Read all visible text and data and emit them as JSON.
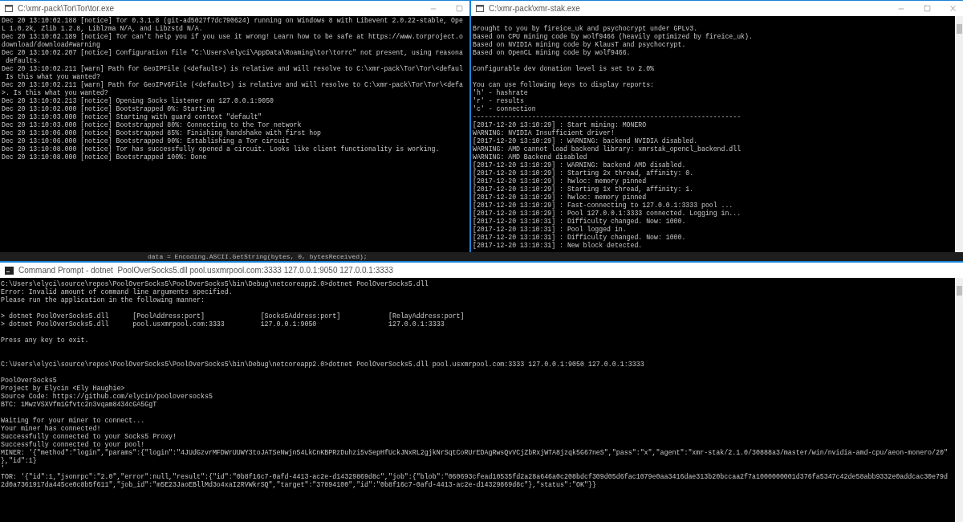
{
  "tor_window": {
    "title": "C:\\xmr-pack\\Tor\\Tor\\tor.exe",
    "groups": [
      {
        "wide_gap": false,
        "lines": [
          "Dec 20 13:10:02.188 [notice] Tor 0.3.1.8 (git-ad5027f7dc790624) running on Windows 8 with Libevent 2.0.22-stable, Ope",
          "L 1.0.2k, Zlib 1.2.8, Liblzma N/A, and Libzstd N/A.",
          "Dec 20 13:10:02.189 [notice] Tor can't help you if you use it wrong! Learn how to be safe at https://www.torproject.o",
          "download/download#warning",
          "Dec 20 13:10:02.207 [notice] Configuration file \"C:\\Users\\elyci\\AppData\\Roaming\\tor\\torrc\" not present, using reasona",
          " defaults.",
          "Dec 20 13:10:02.211 [warn] Path for GeoIPFile (<default>) is relative and will resolve to C:\\xmr-pack\\Tor\\Tor\\<defaul",
          " Is this what you wanted?",
          "Dec 20 13:10:02.211 [warn] Path for GeoIPv6File (<default>) is relative and will resolve to C:\\xmr-pack\\Tor\\Tor\\<defa",
          ">. Is this what you wanted?",
          "Dec 20 13:10:02.213 [notice] Opening Socks listener on 127.0.0.1:9050",
          "Dec 20 13:10:02.000 [notice] Bootstrapped 0%: Starting",
          "Dec 20 13:10:03.000 [notice] Starting with guard context \"default\"",
          "Dec 20 13:10:03.000 [notice] Bootstrapped 80%: Connecting to the Tor network",
          "Dec 20 13:10:06.000 [notice] Bootstrapped 85%: Finishing handshake with first hop",
          "Dec 20 13:10:06.000 [notice] Bootstrapped 90%: Establishing a Tor circuit",
          "Dec 20 13:10:08.000 [notice] Tor has successfully opened a circuit. Looks like client functionality is working.",
          "Dec 20 13:10:08.000 [notice] Bootstrapped 100%: Done"
        ]
      }
    ]
  },
  "editor_behind": {
    "code_line": "data = Encoding.ASCII.GetString(bytes, 0, bytesReceived);"
  },
  "miner_window": {
    "title": "C:\\xmr-pack\\xmr-stak.exe",
    "groups": [
      {
        "wide_gap": false,
        "lines": [
          "Brought to you by fireice_uk and psychocrypt under GPLv3.",
          "Based on CPU mining code by wolf9466 (heavily optimized by fireice_uk).",
          "Based on NVIDIA mining code by KlausT and psychocrypt.",
          "Based on OpenCL mining code by wolf9466."
        ]
      },
      {
        "wide_gap": false,
        "lines": [
          "Configurable dev donation level is set to 2.0%"
        ]
      },
      {
        "wide_gap": false,
        "lines": [
          "You can use following keys to display reports:",
          "'h' - hashrate",
          "'r' - results",
          "'c' - connection",
          "--------------------------------------------------------------------",
          "[2017-12-20 13:10:29] : Start mining: MONERO",
          "WARNING: NVIDIA Insufficient driver!",
          "[2017-12-20 13:10:29] : WARNING: backend NVIDIA disabled.",
          "WARNING: AMD cannot load backend library: xmrstak_opencl_backend.dll",
          "WARNING: AMD Backend disabled",
          "[2017-12-20 13:10:29] : WARNING: backend AMD disabled.",
          "[2017-12-20 13:10:29] : Starting 2x thread, affinity: 0.",
          "[2017-12-20 13:10:29] : hwloc: memory pinned",
          "[2017-12-20 13:10:29] : Starting 1x thread, affinity: 1.",
          "[2017-12-20 13:10:29] : hwloc: memory pinned",
          "[2017-12-20 13:10:29] : Fast-connecting to 127.0.0.1:3333 pool ...",
          "[2017-12-20 13:10:29] : Pool 127.0.0.1:3333 connected. Logging in...",
          "[2017-12-20 13:10:31] : Difficulty changed. Now: 1000.",
          "[2017-12-20 13:10:31] : Pool logged in.",
          "[2017-12-20 13:10:31] : Difficulty changed. Now: 1000.",
          "[2017-12-20 13:10:31] : New block detected."
        ]
      }
    ]
  },
  "proxy_window": {
    "title": "Command Prompt - dotnet  PoolOverSocks5.dll pool.usxmrpool.com:3333 127.0.0.1:9050 127.0.0.1:3333",
    "groups": [
      {
        "wide_gap": false,
        "lines": [
          "C:\\Users\\elyci\\source\\repos\\PoolOverSocks5\\PoolOverSocks5\\bin\\Debug\\netcoreapp2.0>dotnet PoolOverSocks5.dll",
          "Error: Invalid amount of command line arguments specified.",
          "Please run the application in the following manner:"
        ]
      },
      {
        "wide_gap": false,
        "lines": [
          "> dotnet PoolOverSocks5.dll      [PoolAddress:port]              [Socks5Address:port]            [RelayAddress:port]",
          "> dotnet PoolOverSocks5.dll      pool.usxmrpool.com:3333         127.0.0.1:9050                  127.0.0.1:3333"
        ]
      },
      {
        "wide_gap": false,
        "lines": [
          "Press any key to exit."
        ]
      },
      {
        "wide_gap": true,
        "lines": [
          "C:\\Users\\elyci\\source\\repos\\PoolOverSocks5\\PoolOverSocks5\\bin\\Debug\\netcoreapp2.0>dotnet PoolOverSocks5.dll pool.usxmrpool.com:3333 127.0.0.1:9050 127.0.0.1:3333"
        ]
      },
      {
        "wide_gap": false,
        "lines": [
          "PoolOverSocks5",
          "Project by Elycin <Ely Haughie>",
          "Source Code: https://github.com/elycin/pooloversocks5",
          "BTC: 1MwzVSXVfm1Gfvtc2n3vqam8434cGA5GgT"
        ]
      },
      {
        "wide_gap": false,
        "lines": [
          "Waiting for your miner to connect...",
          "Your miner has connected!",
          "Successfully connected to your Socks5 Proxy!",
          "Successfully connected to your pool!",
          "MINER: '{\"method\":\"login\",\"params\":{\"login\":\"4JUdGzvrMFDWrUUWY3toJATSeNwjn54LkCnKBPRzDuhzi5vSepHfUckJNxRL2gjkNrSqtCoRUrEDAgRwsQvVCjZbRxjWTA8jzqk5G67neS\",\"pass\":\"x\",\"agent\":\"xmr-stak/2.1.0/30888a3/master/win/nvidia-amd-cpu/aeon-monero/20\"",
          "},\"id\":1}",
          "'",
          "TOR: '{\"id\":1,\"jsonrpc\":\"2.0\",\"error\":null,\"result\":{\"id\":\"0b8f16c7-0afd-4413-ac2e-d14329869d8c\",\"job\":{\"blob\":\"060693cfead10535fd2a28a646a0c208bdcf309d05d6fac1079e0aa3416dae313b20bccaa2f7a1000000001d376fa5347c42de58abb9332e0addcac30e79d",
          "2d0a7361917da445ce0c8b5f611\",\"job_id\":\"m5E23JaoEBllMd3o4xaI2RVWkrSQ\",\"target\":\"37894100\",\"id\":\"0b8f16c7-0afd-4413-ac2e-d14329869d8c\"},\"status\":\"OK\"}}"
        ]
      }
    ]
  }
}
